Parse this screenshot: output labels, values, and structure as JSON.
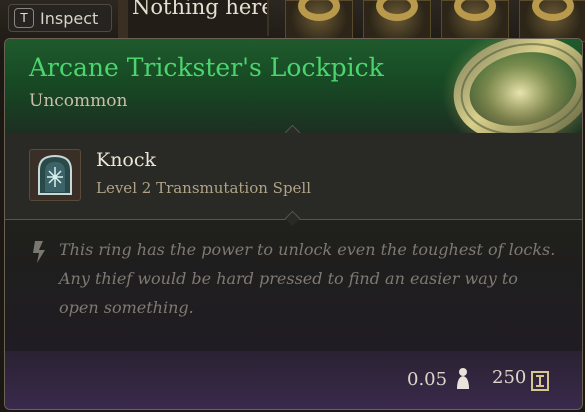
{
  "inspect": {
    "key": "T",
    "label": "Inspect"
  },
  "background": {
    "name_text": "Nothing here"
  },
  "item": {
    "name": "Arcane Trickster's Lockpick",
    "rarity": "Uncommon",
    "rarity_color": "#4cd46f"
  },
  "spell": {
    "name": "Knock",
    "level": "Level 2 Transmutation Spell",
    "icon": "knock-spell-icon"
  },
  "description": "This ring has the power to unlock even the toughest of locks. Any thief would be hard pressed to find an easier way to open something.",
  "footer": {
    "weight": "0.05",
    "weight_icon": "weight-icon",
    "value": "250",
    "value_icon": "gold-icon"
  }
}
